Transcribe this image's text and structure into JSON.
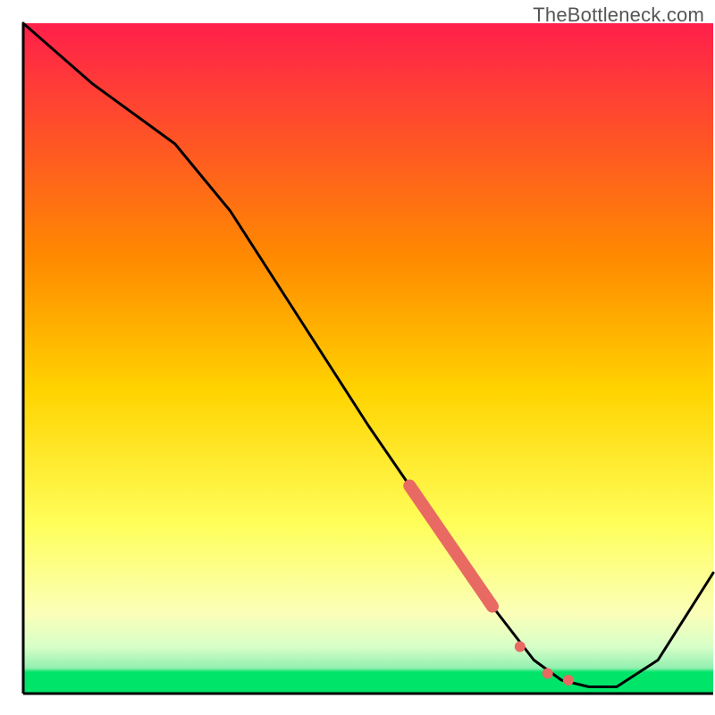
{
  "watermark": "TheBottleneck.com",
  "colors": {
    "gradient_top": "#ff1f4b",
    "gradient_mid1": "#ff8a00",
    "gradient_mid2": "#ffd400",
    "gradient_mid3": "#ffff5c",
    "gradient_bottom": "#00e46a",
    "axis": "#000000",
    "line": "#000000",
    "marker": "#e86a63",
    "marker_light": "#f2948e"
  },
  "chart_data": {
    "type": "line",
    "title": "",
    "xlabel": "",
    "ylabel": "",
    "xlim": [
      0,
      100
    ],
    "ylim": [
      0,
      100
    ],
    "series": [
      {
        "name": "curve",
        "x": [
          0,
          10,
          22,
          30,
          40,
          50,
          60,
          68,
          74,
          78,
          82,
          86,
          92,
          100
        ],
        "values": [
          100,
          91,
          82,
          72,
          56,
          40,
          25,
          13,
          5,
          2,
          1,
          1,
          5,
          18
        ]
      }
    ],
    "highlight_segment": {
      "name": "dense-markers",
      "x_start": 56,
      "x_end": 68,
      "y_start": 31,
      "y_end": 13
    },
    "extra_markers": [
      {
        "x": 72,
        "y": 7
      },
      {
        "x": 76,
        "y": 3
      },
      {
        "x": 79,
        "y": 2
      }
    ]
  }
}
